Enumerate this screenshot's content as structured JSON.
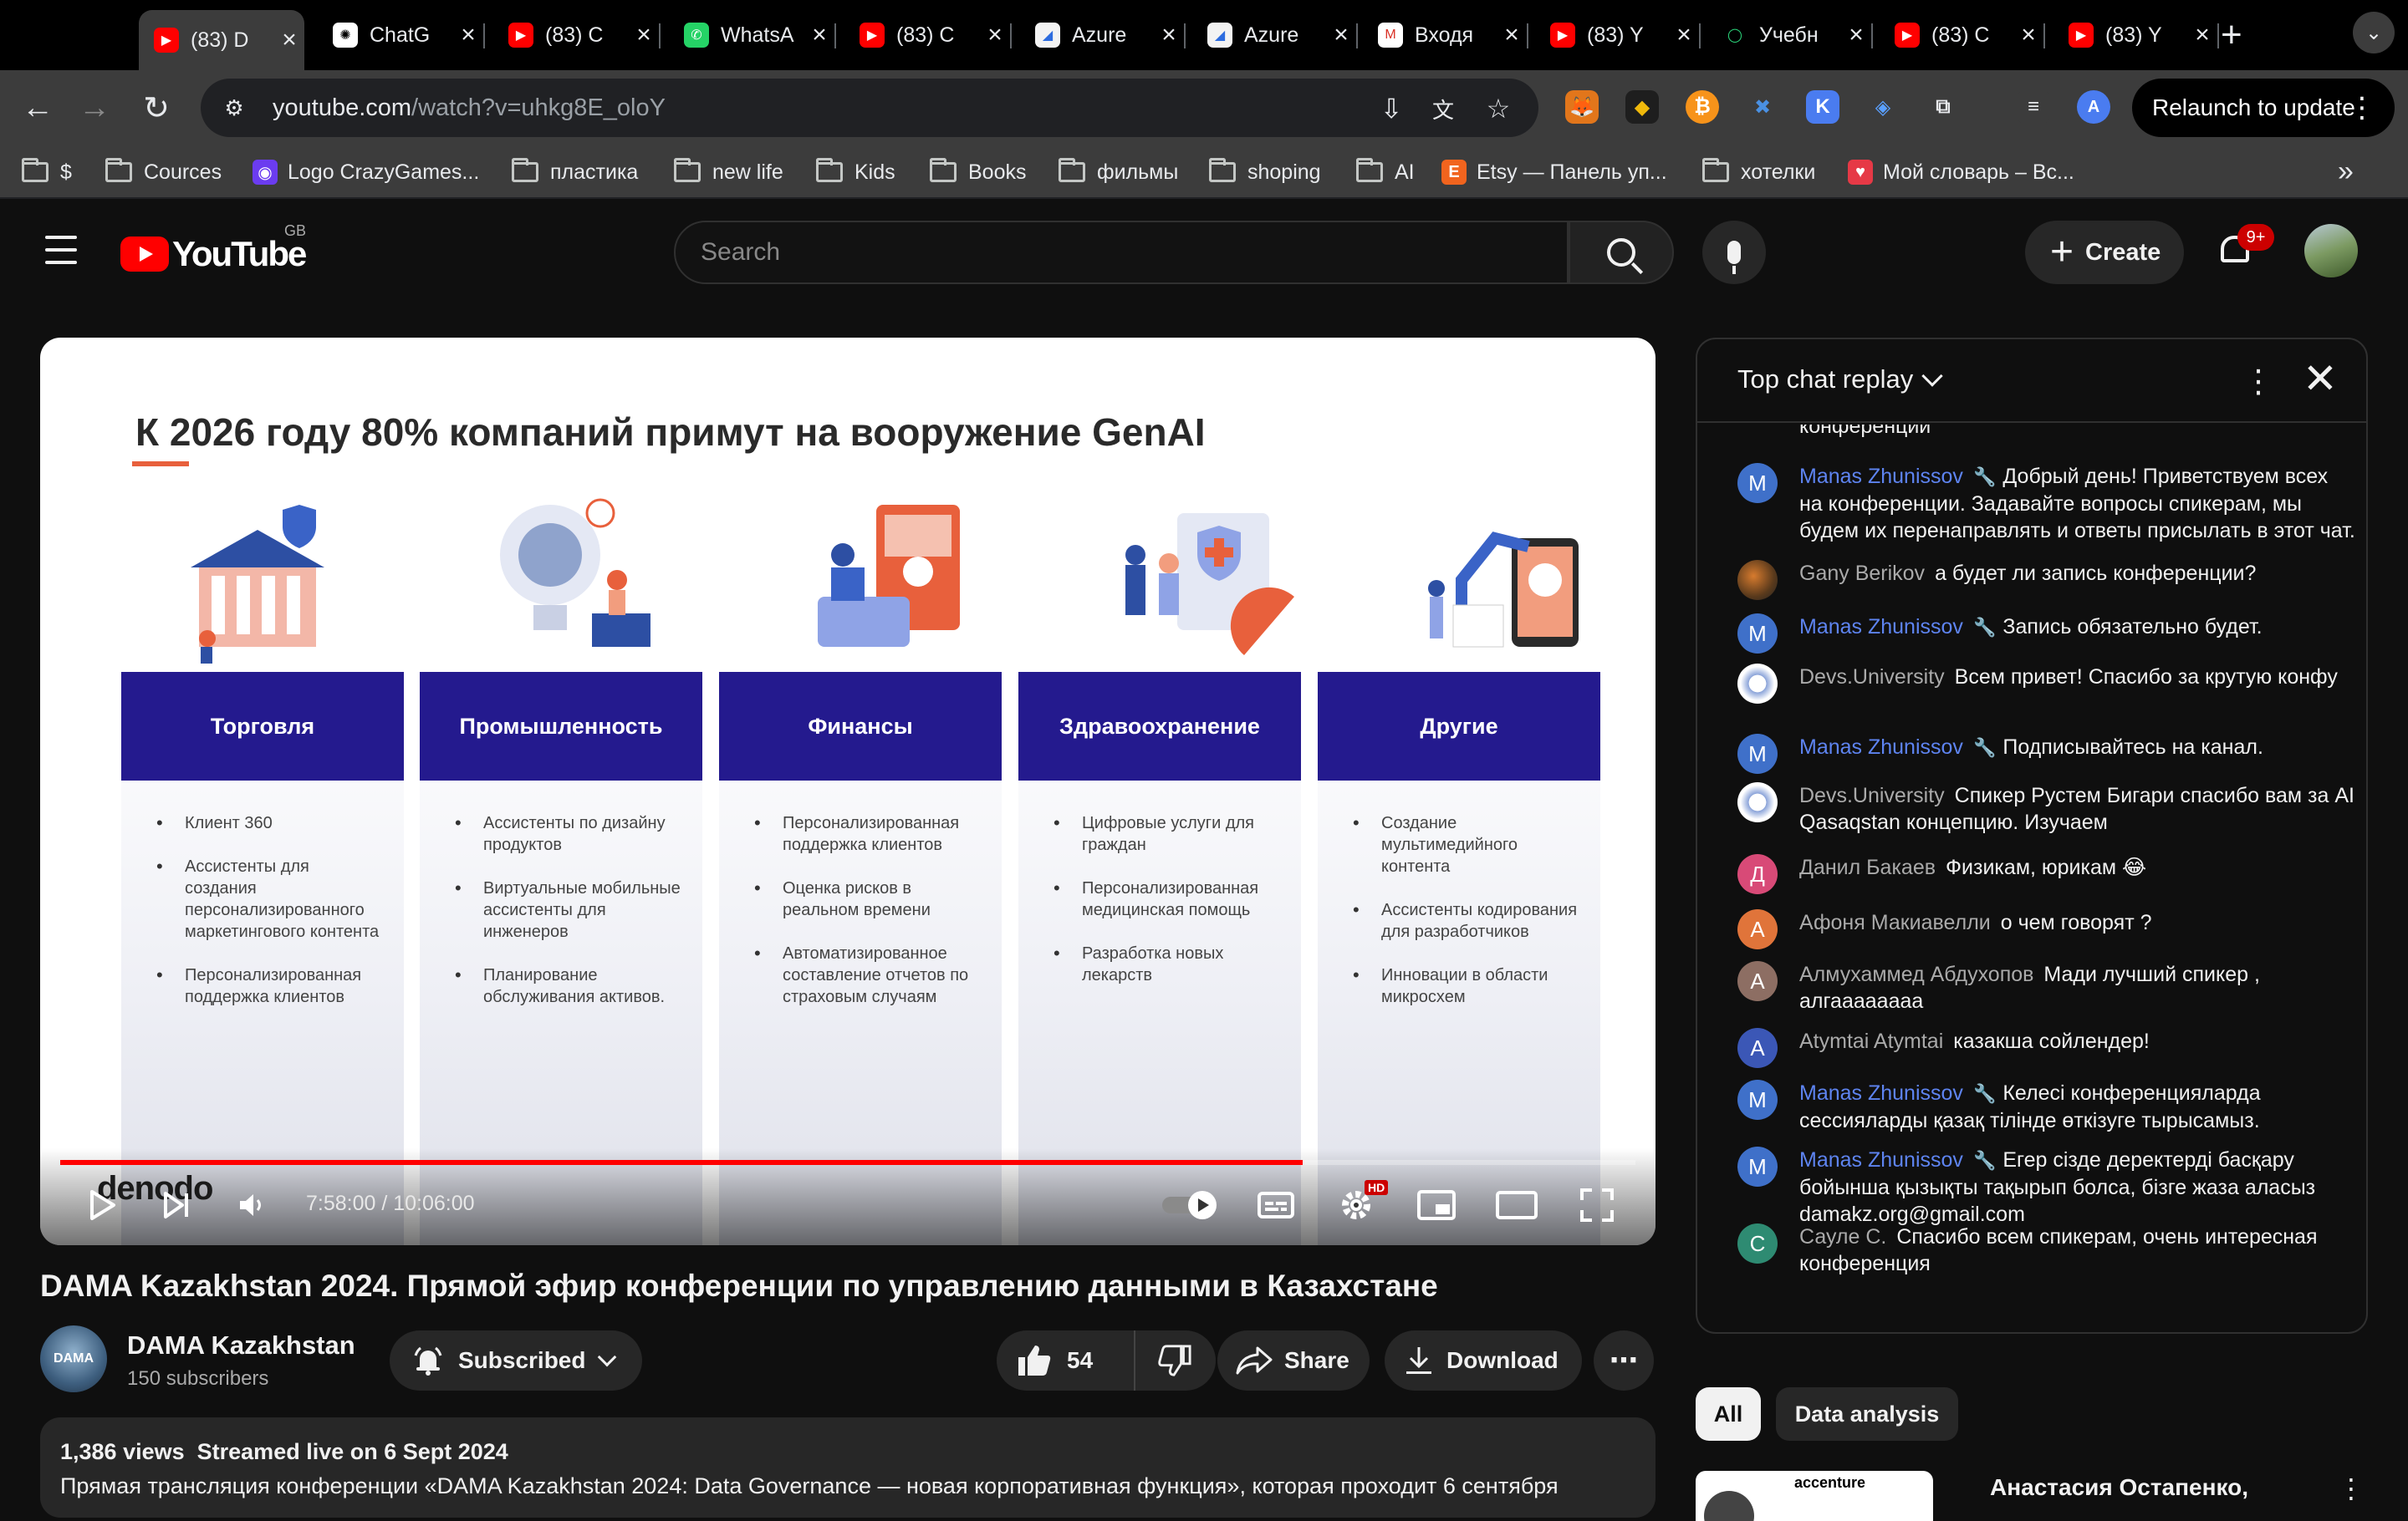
{
  "browser": {
    "tabs": [
      {
        "title": "(83) D",
        "icon": "youtube-icon",
        "active": true
      },
      {
        "title": "ChatG",
        "icon": "chatgpt-icon"
      },
      {
        "title": "(83) C",
        "icon": "youtube-icon"
      },
      {
        "title": "WhatsA",
        "icon": "whatsapp-icon"
      },
      {
        "title": "(83) C",
        "icon": "youtube-icon"
      },
      {
        "title": "Azure",
        "icon": "azure-icon"
      },
      {
        "title": "Azure",
        "icon": "azure-icon"
      },
      {
        "title": "Входя",
        "icon": "gmail-icon"
      },
      {
        "title": "(83) Y",
        "icon": "youtube-icon"
      },
      {
        "title": "Учебн",
        "icon": "green-circle-icon"
      },
      {
        "title": "(83) C",
        "icon": "youtube-icon"
      },
      {
        "title": "(83) Y",
        "icon": "youtube-icon"
      }
    ],
    "url_host": "youtube.com",
    "url_path": "/watch?v=uhkg8E_oloY",
    "relaunch_label": "Relaunch to update",
    "extension_badge": "A",
    "bookmarks": [
      {
        "label": "$",
        "type": "folder"
      },
      {
        "label": "Cources",
        "type": "folder"
      },
      {
        "label": "Logo CrazyGames...",
        "type": "site"
      },
      {
        "label": "пластика",
        "type": "folder"
      },
      {
        "label": "new life",
        "type": "folder"
      },
      {
        "label": "Kids",
        "type": "folder"
      },
      {
        "label": "Books",
        "type": "folder"
      },
      {
        "label": "фильмы",
        "type": "folder"
      },
      {
        "label": "shoping",
        "type": "folder"
      },
      {
        "label": "AI",
        "type": "folder"
      },
      {
        "label": "Etsy — Панель уп...",
        "type": "site"
      },
      {
        "label": "хотелки",
        "type": "folder"
      },
      {
        "label": "Мой словарь – Вс...",
        "type": "site"
      }
    ]
  },
  "youtube": {
    "logo_text": "YouTube",
    "country_code": "GB",
    "search_placeholder": "Search",
    "create_label": "Create",
    "notification_badge": "9+"
  },
  "slide": {
    "title": "К 2026 году 80% компаний примут на вооружение GenAI",
    "logo": "denodo",
    "columns": [
      {
        "heading": "Торговля",
        "items": [
          "Клиент 360",
          "Ассистенты для создания персонализированного маркетингового контента",
          "Персонализированная поддержка клиентов"
        ]
      },
      {
        "heading": "Промышленность",
        "items": [
          "Ассистенты по дизайну продуктов",
          "Виртуальные мобильные ассистенты для инженеров",
          "Планирование обслуживания активов."
        ]
      },
      {
        "heading": "Финансы",
        "items": [
          "Персонализированная поддержка клиентов",
          "Оценка рисков в реальном времени",
          "Автоматизированное составление отчетов по страховым случаям"
        ]
      },
      {
        "heading": "Здравоохранение",
        "items": [
          "Цифровые услуги для граждан",
          "Персонализированная медицинская помощь",
          "Разработка новых лекарств"
        ]
      },
      {
        "heading": "Другие",
        "items": [
          "Создание мультимедийного контента",
          "Ассистенты кодирования для разработчиков",
          "Инновации в области микросхем"
        ]
      }
    ]
  },
  "player": {
    "time_display": "7:58:00 / 10:06:00",
    "progress_fraction": 0.789,
    "hd_badge": "HD"
  },
  "video": {
    "title": "DAMA Kazakhstan 2024. Прямой эфир конференции по управлению данными в Казахстане",
    "channel_name": "DAMA Kazakhstan",
    "channel_avatar_text": "DAMA",
    "subscribers": "150 subscribers",
    "subscribed_label": "Subscribed",
    "likes": "54",
    "share_label": "Share",
    "download_label": "Download",
    "views": "1,386 views",
    "streamed": "Streamed live on 6 Sept 2024",
    "description_line": "Прямая трансляция конференции «DAMA Kazakhstan 2024: Data Governance — новая корпоративная функция», которая проходит 6 сентября"
  },
  "chat": {
    "title": "Top chat replay",
    "partial_first": "конференции",
    "messages": [
      {
        "avatar": "M",
        "color": "#3f70c9",
        "author": "Manas Zhunissov",
        "mod": true,
        "text": "Добрый день! Приветствуем всех на конференции. Задавайте вопросы спикерам, мы будем их перенаправлять и ответы присылать в этот чат."
      },
      {
        "avatar": "",
        "color": "#5a4b2c",
        "author": "Gany Berikov",
        "mod": false,
        "text": "а будет ли запись конференции?"
      },
      {
        "avatar": "M",
        "color": "#3f70c9",
        "author": "Manas Zhunissov",
        "mod": true,
        "text": "Запись обязательно будет."
      },
      {
        "avatar": "",
        "color": "#e8eef8",
        "author": "Devs.University",
        "mod": false,
        "text": "Всем привет! Спасибо за крутую конфу"
      },
      {
        "avatar": "M",
        "color": "#3f70c9",
        "author": "Manas Zhunissov",
        "mod": true,
        "text": "Подписывайтесь на канал."
      },
      {
        "avatar": "",
        "color": "#e8eef8",
        "author": "Devs.University",
        "mod": false,
        "text": "Спикер Рустем Бигари спасибо вам за AI Qasaqstan концепцию. Изучаем"
      },
      {
        "avatar": "Д",
        "color": "#d84a77",
        "author": "Данил Бакаев",
        "mod": false,
        "text": "Физикам, юрикам 😂"
      },
      {
        "avatar": "А",
        "color": "#e0743a",
        "author": "Афоня Макиавелли",
        "mod": false,
        "text": "о чем говорят ?"
      },
      {
        "avatar": "А",
        "color": "#8d6e63",
        "author": "Алмухаммед Абдухопов",
        "mod": false,
        "text": "Мади лучший спикер , алгаааааааа"
      },
      {
        "avatar": "A",
        "color": "#3b57b6",
        "author": "Atymtai Atymtai",
        "mod": false,
        "text": "казакша сойлендер!"
      },
      {
        "avatar": "M",
        "color": "#3f70c9",
        "author": "Manas Zhunissov",
        "mod": true,
        "text": "Келесі конференцияларда сессияларды қазақ тілінде өткізуге тырысамыз."
      },
      {
        "avatar": "M",
        "color": "#3f70c9",
        "author": "Manas Zhunissov",
        "mod": true,
        "text": "Егер сізде деректерді басқару бойынша қызықты тақырып болса, бізге жаза аласыз damakz.org@gmail.com"
      },
      {
        "avatar": "С",
        "color": "#2e8b72",
        "author": "Сауле С.",
        "mod": false,
        "text": "Спасибо всем спикерам, очень интересная конференция"
      }
    ]
  },
  "chips": [
    "All",
    "Data analysis"
  ],
  "related": {
    "title": "Анастасия Остапенко,",
    "thumb_text": "accenture"
  }
}
